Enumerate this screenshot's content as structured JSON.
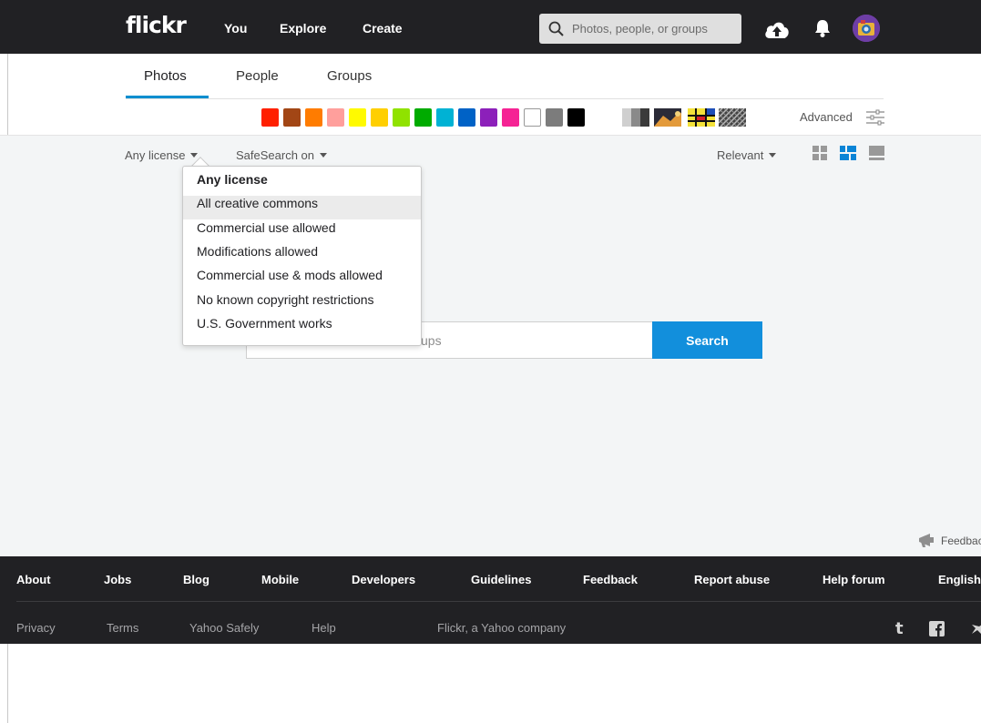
{
  "nav": {
    "logo": "flickr",
    "links": [
      "You",
      "Explore",
      "Create"
    ],
    "search_placeholder": "Photos, people, or groups"
  },
  "tabs": [
    "Photos",
    "People",
    "Groups"
  ],
  "colors": [
    "#ff2000",
    "#a24615",
    "#ff7c00",
    "#ff9f9c",
    "#fffa00",
    "#ffcf00",
    "#90e200",
    "#00ab00",
    "#00b2d4",
    "#0062c6",
    "#8c20ba",
    "#f52394",
    "#ffffff",
    "#7c7c7c",
    "#000000"
  ],
  "advanced_label": "Advanced",
  "filters": {
    "license": "Any license",
    "safesearch": "SafeSearch on",
    "sort": "Relevant"
  },
  "license_options": [
    "Any license",
    "All creative commons",
    "Commercial use allowed",
    "Modifications allowed",
    "Commercial use & mods allowed",
    "No known copyright restrictions",
    "U.S. Government works"
  ],
  "main_search": {
    "placeholder_visible": "ups",
    "button": "Search"
  },
  "feedback_label": "Feedback",
  "footer": {
    "main_links": [
      "About",
      "Jobs",
      "Blog",
      "Mobile",
      "Developers",
      "Guidelines",
      "Feedback",
      "Report abuse",
      "Help forum",
      "English"
    ],
    "sub_links": [
      "Privacy",
      "Terms",
      "Yahoo Safely",
      "Help"
    ],
    "company": "Flickr, a Yahoo company"
  }
}
